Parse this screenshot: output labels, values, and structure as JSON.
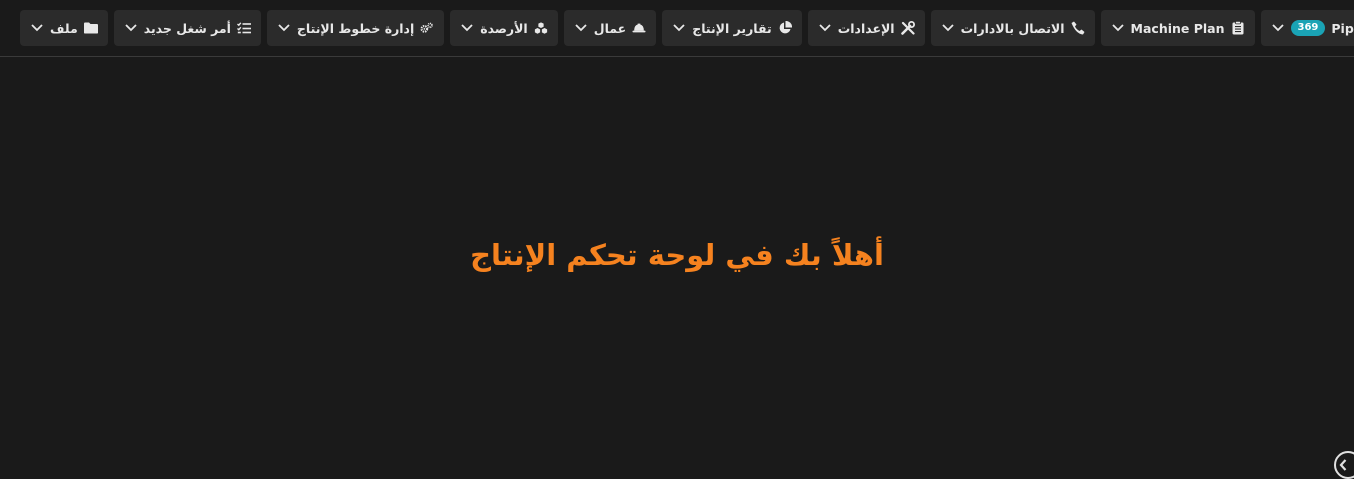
{
  "menubar": {
    "items": [
      {
        "label": "ملف",
        "icon": "folder-icon"
      },
      {
        "label": "أمر شغل جديد",
        "icon": "checklist-icon"
      },
      {
        "label": "إدارة خطوط الإنتاج",
        "icon": "gears-icon"
      },
      {
        "label": "الأرصدة",
        "icon": "cubes-icon"
      },
      {
        "label": "عمال",
        "icon": "hard-hat-icon"
      },
      {
        "label": "تقارير الإنتاج",
        "icon": "pie-chart-icon"
      },
      {
        "label": "الإعدادات",
        "icon": "tools-icon"
      },
      {
        "label": "الاتصال بالادارات",
        "icon": "phone-icon"
      },
      {
        "label": "Machine Plan",
        "icon": "clipboard-icon"
      },
      {
        "label": "Pipeline",
        "icon": "list-icon",
        "badge": "369"
      }
    ]
  },
  "main": {
    "welcome_text": "أهلاً بك في لوحة تحكم الإنتاج"
  },
  "colors": {
    "background": "#1a1a1a",
    "menu_bg": "#2b2b2b",
    "menu_text": "#e8e8e8",
    "accent_orange": "#f5821f",
    "badge_teal": "#1aa3b5"
  }
}
